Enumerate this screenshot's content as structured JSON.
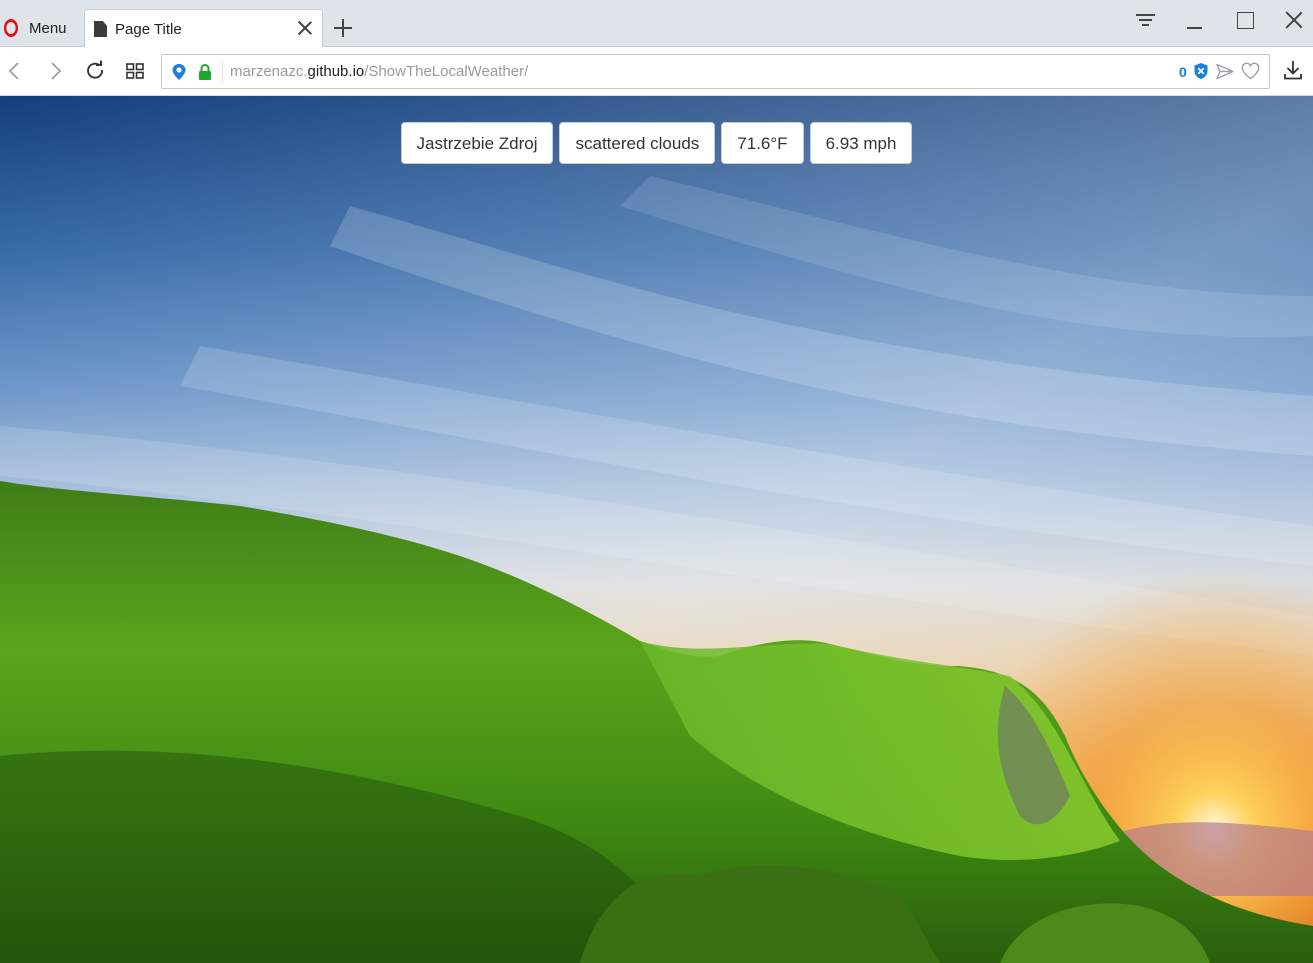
{
  "browser": {
    "menu_label": "Menu",
    "tab": {
      "title": "Page Title"
    },
    "address": {
      "prefix": "marzenazc.",
      "host": "github.io",
      "path": "/ShowTheLocalWeather/"
    },
    "tracker_count": "0",
    "icons": [
      "opera-icon",
      "document-icon",
      "close-icon",
      "plus-icon",
      "tab-menu-icon",
      "minimize-icon",
      "maximize-icon",
      "close-icon",
      "back-icon",
      "forward-icon",
      "reload-icon",
      "speed-dial-icon",
      "location-pin-icon",
      "lock-icon",
      "shield-icon",
      "send-icon",
      "heart-icon",
      "download-icon"
    ],
    "colors": {
      "opera_red": "#e2101b",
      "lock_green": "#1ea630",
      "tracker_blue": "#1a7de0"
    }
  },
  "weather": {
    "location": "Jastrzebie Zdroj",
    "description": "scattered clouds",
    "temperature": "71.6°F",
    "wind": "6.93 mph"
  }
}
